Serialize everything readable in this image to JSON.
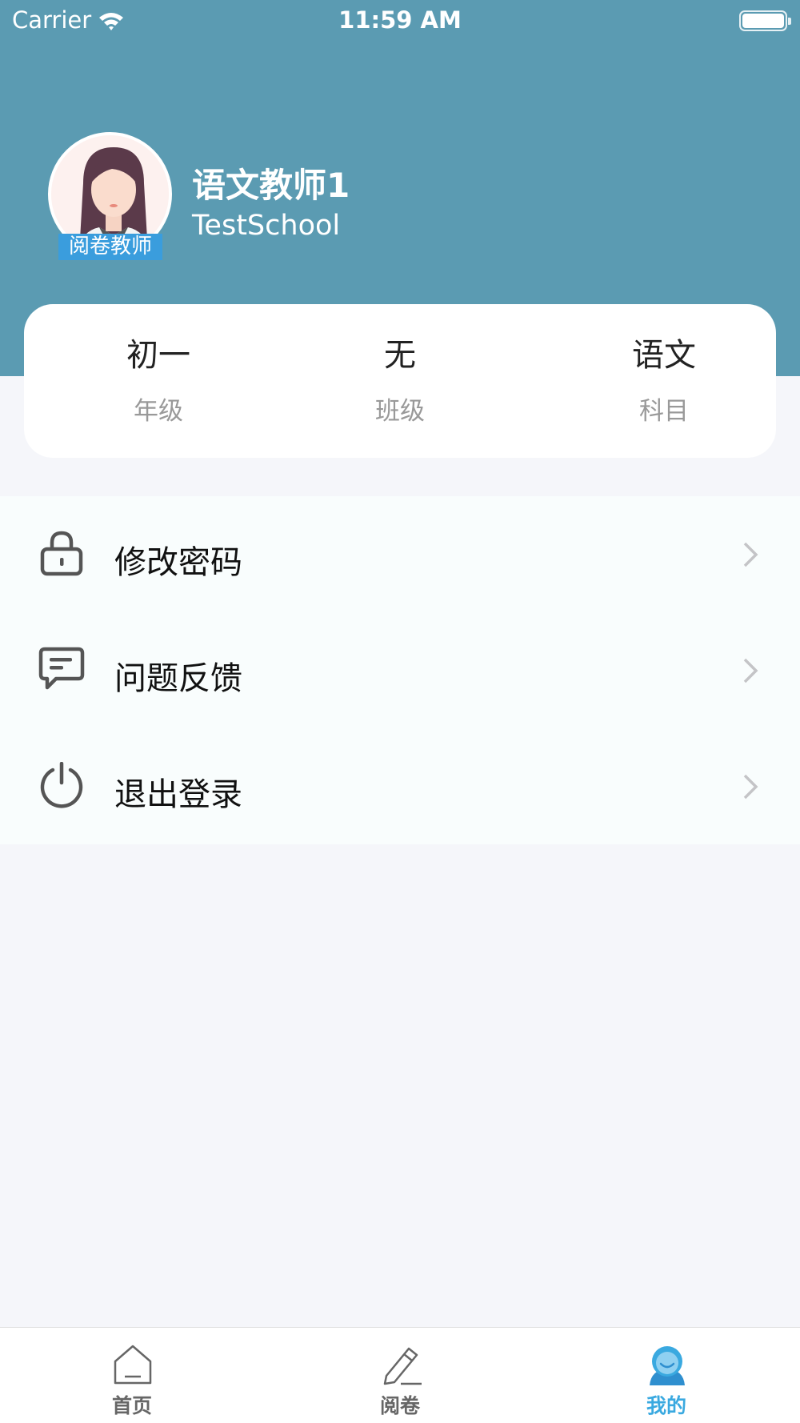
{
  "status_bar": {
    "carrier": "Carrier",
    "time": "11:59 AM"
  },
  "profile": {
    "avatar_badge": "阅卷教师",
    "name": "语文教师1",
    "school": "TestSchool"
  },
  "stats": [
    {
      "value": "初一",
      "label": "年级"
    },
    {
      "value": "无",
      "label": "班级"
    },
    {
      "value": "语文",
      "label": "科目"
    }
  ],
  "menu": [
    {
      "label": "修改密码",
      "icon": "lock-icon"
    },
    {
      "label": "问题反馈",
      "icon": "chat-icon"
    },
    {
      "label": "退出登录",
      "icon": "power-icon"
    }
  ],
  "tabbar": [
    {
      "label": "首页",
      "icon": "home-icon",
      "active": false
    },
    {
      "label": "阅卷",
      "icon": "pencil-icon",
      "active": false
    },
    {
      "label": "我的",
      "icon": "user-icon",
      "active": true
    }
  ],
  "colors": {
    "header": "#5b9bb2",
    "accent": "#3aa9e0",
    "badge": "#3a9ddd"
  }
}
